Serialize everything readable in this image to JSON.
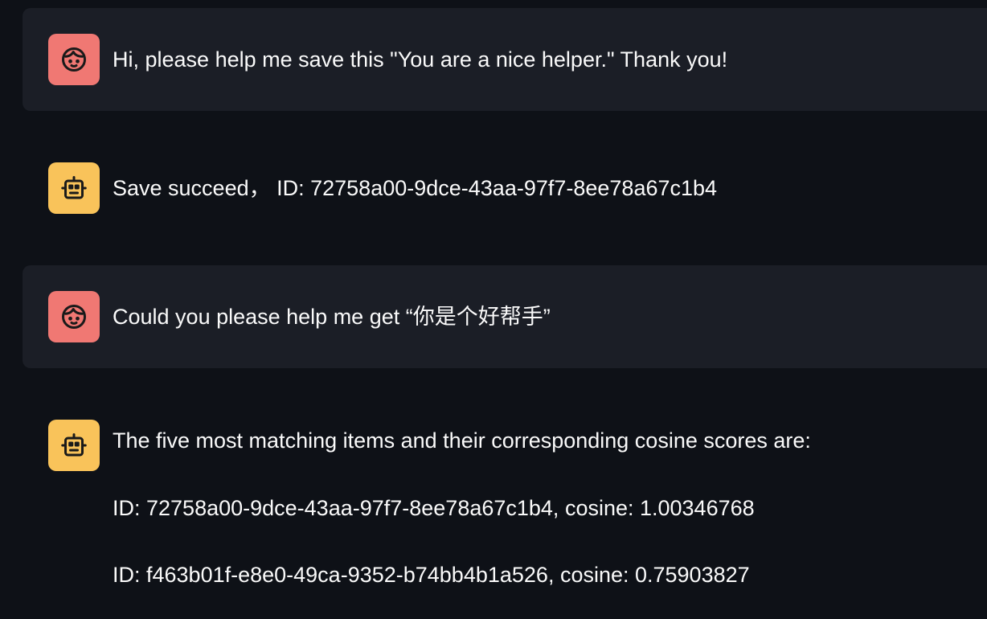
{
  "messages": [
    {
      "role": "user",
      "avatar_icon": "face-icon",
      "text": "Hi, please help me save this \"You are a nice helper.\" Thank you!"
    },
    {
      "role": "assistant",
      "avatar_icon": "robot-icon",
      "text": "Save succeed， ID: 72758a00-9dce-43aa-97f7-8ee78a67c1b4"
    },
    {
      "role": "user",
      "avatar_icon": "face-icon",
      "text": "Could you please help me get “你是个好帮手”"
    },
    {
      "role": "assistant",
      "avatar_icon": "robot-icon",
      "text": "The five most matching items and their corresponding cosine scores are:",
      "results": [
        "ID: 72758a00-9dce-43aa-97f7-8ee78a67c1b4, cosine: 1.00346768",
        "ID: f463b01f-e8e0-49ca-9352-b74bb4b1a526, cosine: 0.75903827"
      ]
    }
  ],
  "colors": {
    "background": "#0e1117",
    "user_bubble": "#1b1e26",
    "user_avatar": "#f07873",
    "assistant_avatar": "#f9c35a",
    "text": "#fafafa"
  }
}
